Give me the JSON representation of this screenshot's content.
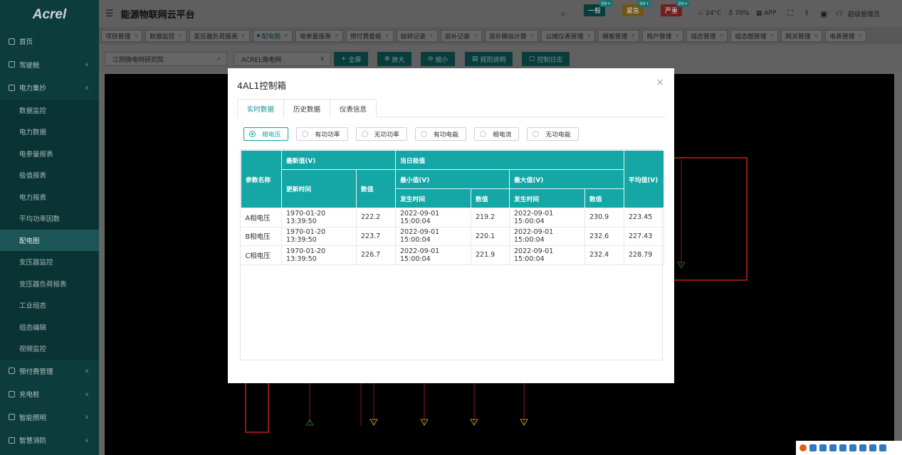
{
  "app": {
    "logo": "Acrel",
    "title": "能源物联网云平台"
  },
  "sidebar": {
    "top_items": [
      {
        "label": "首页"
      },
      {
        "label": "驾驶舱"
      },
      {
        "label": "电力集抄"
      }
    ],
    "sub_items": [
      {
        "label": "数据监控"
      },
      {
        "label": "电力数据"
      },
      {
        "label": "电参量报表"
      },
      {
        "label": "极值报表"
      },
      {
        "label": "电力报表"
      },
      {
        "label": "平均功率因数"
      },
      {
        "label": "配电图"
      },
      {
        "label": "变压器监控"
      },
      {
        "label": "变压器负荷报表"
      },
      {
        "label": "工业组态"
      },
      {
        "label": "组态编辑"
      },
      {
        "label": "视频监控"
      }
    ],
    "bottom_items": [
      {
        "label": "预付费管理"
      },
      {
        "label": "充电桩"
      },
      {
        "label": "智能照明"
      },
      {
        "label": "智慧消防"
      }
    ]
  },
  "header": {
    "alarms": [
      {
        "label": "一般",
        "count": "99+",
        "color": "#0b4b4a"
      },
      {
        "label": "紧急",
        "count": "99+",
        "color": "#8a6a1a"
      },
      {
        "label": "严重",
        "count": "99+",
        "color": "#8e2727"
      }
    ],
    "temperature": "24°C",
    "humidity": "70%",
    "app_label": "APP",
    "user": "超级管理员"
  },
  "tabs": [
    "项目管理",
    "数据监控",
    "变压器负荷报表",
    "配电图",
    "电参量报表",
    "预付费看板",
    "结转记录",
    "退补记录",
    "退补模拟计算",
    "公摊仪表管理",
    "模板管理",
    "商户管理",
    "组态管理",
    "组态图管理",
    "网关管理",
    "电表管理"
  ],
  "toolbar": {
    "site_value": "江阴微电网研究院",
    "grid_value": "ACREL微电网",
    "buttons": [
      "全屏",
      "放大",
      "缩小",
      "规则说明",
      "控制日志"
    ]
  },
  "modal": {
    "title": "4AL1控制箱",
    "tabs": [
      "实时数据",
      "历史数据",
      "仪表信息"
    ],
    "radio_options": [
      "相电压",
      "有功功率",
      "无功功率",
      "有功电能",
      "相电流",
      "无功电能"
    ],
    "table": {
      "header_param": "参数名称",
      "header_latest": "最新值(V)",
      "header_today": "当日极值",
      "header_min": "最小值(V)",
      "header_max": "最大值(V)",
      "header_avg": "平均值(V)",
      "header_update_time": "更新时间",
      "header_value": "数值",
      "header_occur_time": "发生时间",
      "rows": [
        {
          "name": "A相电压",
          "update": "1970-01-20 13:39:50",
          "latest": "222.2",
          "min_time": "2022-09-01 15:00:04",
          "min": "219.2",
          "max_time": "2022-09-01 15:00:04",
          "max": "230.9",
          "avg": "223.45"
        },
        {
          "name": "B相电压",
          "update": "1970-01-20 13:39:50",
          "latest": "223.7",
          "min_time": "2022-09-01 15:00:04",
          "min": "220.1",
          "max_time": "2022-09-01 15:00:04",
          "max": "232.6",
          "avg": "227.43"
        },
        {
          "name": "C相电压",
          "update": "1970-01-20 13:39:50",
          "latest": "226.7",
          "min_time": "2022-09-01 15:00:04",
          "min": "221.9",
          "max_time": "2022-09-01 15:00:04",
          "max": "232.4",
          "avg": "228.79"
        }
      ]
    }
  }
}
